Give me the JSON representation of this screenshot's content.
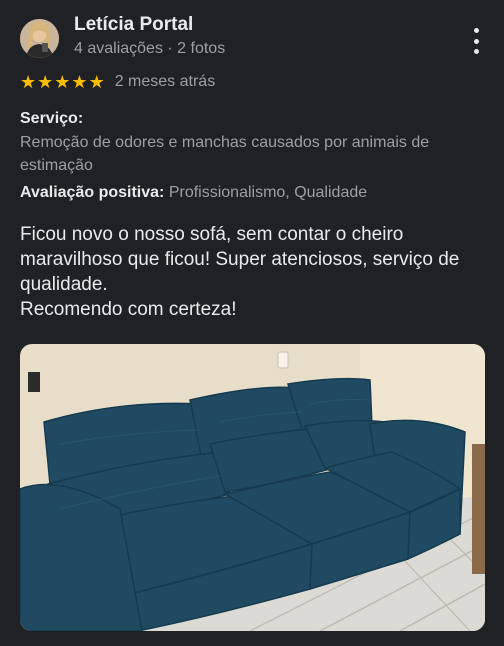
{
  "review": {
    "author": "Letícia Portal",
    "meta": "4 avaliações · 2 fotos",
    "stars": 5,
    "time_ago": "2 meses atrás",
    "service_label": "Serviço:",
    "service_value": "Remoção de odores e manchas causados por animais de estimação",
    "positive_label": "Avaliação positiva:",
    "positive_value": "Profissionalismo, Qualidade",
    "text_line1": "Ficou novo o nosso sofá, sem contar o cheiro maravilhoso que ficou! Super atenciosos, serviço de qualidade.",
    "text_line2": "Recomendo com certeza!"
  },
  "icons": {
    "star": "star-icon",
    "more": "more-vertical-icon"
  },
  "colors": {
    "background": "#202124",
    "star": "#fbbc04",
    "secondary_text": "#9aa0a6",
    "primary_text": "#e8eaed"
  }
}
